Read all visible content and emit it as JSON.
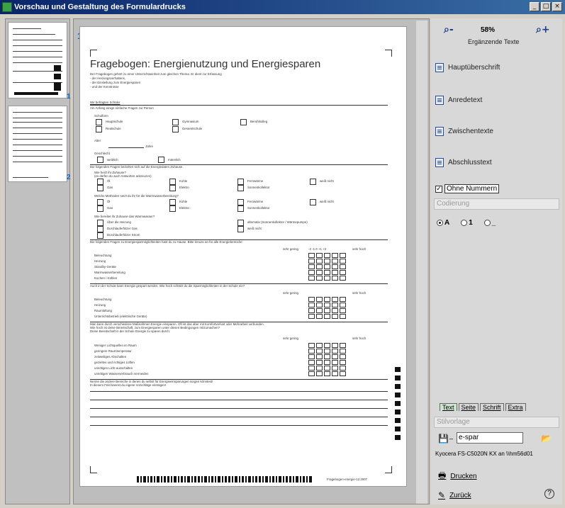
{
  "window": {
    "title": "Vorschau und Gestaltung des Formulardrucks",
    "controls": [
      "_",
      "□",
      "×"
    ]
  },
  "thumbnails": {
    "items": [
      {
        "num": "1"
      },
      {
        "num": "2"
      }
    ]
  },
  "preview": {
    "page_number": "1",
    "doc": {
      "title": "Fragebogen:   Energienutzung und Energiesparen",
      "intro": [
        "Der Fragebogen gehört zu einer Unterrichtseinheit zum gleichen Thema. Er dient zur Erfassung",
        "- der Heizungsverhaltens,",
        "- der Einstellung zum Energiesparen",
        "- und der Kenntnisse"
      ],
      "s1_title": "Wir befragten Schüler",
      "s1_sub": "Am Anfang einige einfache Fragen zur Person",
      "schulform": "Schulform",
      "schulform_opts": [
        "Hauptschule",
        "Realschule",
        "Gymnasium",
        "Gesamtschule",
        "Berufskolleg"
      ],
      "alter": "Alter",
      "jahre": "Jahre",
      "geschlecht": "Geschlecht",
      "geschlecht_opts": [
        "weiblich",
        "männlich"
      ],
      "q_energy": "Die folgenden Fragen beziehen sich auf die Energiedaten Zuhause.",
      "q_heat": "Wie heizt ihr Zuhause?",
      "q_heat_sub": "(es dürfen du auch Antworten ankreuzen)",
      "heat_opts": [
        "Öl",
        "Gas",
        "Kohle",
        "Elektro",
        "Fernwärme",
        "Sonnenkollektor",
        "weiß nicht"
      ],
      "q_warm": "Welche Methoden setzt du ihr für die Warmwasserbereitung?",
      "warm_opts": [
        "Öl",
        "Gas",
        "Kohle",
        "Elektro",
        "Fernwärme",
        "Sonnenkollektor",
        "weiß nicht"
      ],
      "q_water": "Wie bereitet ihr Zuhause das Warmwasser?",
      "water_opts": [
        "Über die Heizung",
        "Durchlauferhitzer Gas",
        "Durchlauferhitzer Strom",
        "alternativ (Sonnenkollektor / Wärmepumpe)",
        "weiß nicht"
      ],
      "q_rate": "Die folgenden Fragen zu Energiesparmöglichkeiten hast du zu Hause. Bitte kreuze an für alle Energiebereiche:",
      "scale_low": "sehr gering",
      "scale_nums": [
        "-2",
        "-1",
        "0",
        "+1",
        "+2"
      ],
      "scale_high": "sehr hoch",
      "rate1_items": [
        "Beleuchtung",
        "Heizung",
        "Standby-Geräte",
        "Warmwasserbereitung",
        "Kochen / Kühlen"
      ],
      "q_school": "Auch in der Schule kann Energie gespart werden. Wie hoch schätzt du die Sparmöglichkeiten in der Schule ein?",
      "rate2_items": [
        "Beleuchtung",
        "Heizung",
        "Raumlüftung",
        "Unterrichtsbetrieb (elektrische Geräte)"
      ],
      "q_measures": "Man kann durch verschiedene Maßnahmen Energie einsparen. Oft ist das aber mit Komfortverlust oder Mehrarbeit verbunden.",
      "q_measures2": "Wie hoch ist deine Bereitschaft, zum Energiesparen unter diesen Bedingungen mitzumachen?",
      "q_measures3": "Deine Bereitschaft in der Schule Energie zu sparen durch:",
      "rate3_items": [
        "Weniger Lichtquellen im Raum",
        "geringere Raumtemperatur",
        "zeitweiliges Abschalten",
        "gezieltes und richtiges Lüften",
        "unnötiges Licht ausschalten",
        "unnötigen Wasserverbrauch vermeiden"
      ],
      "q_free": "Nenne die andere Bereiche in denen du selbst für Energieeinsparungen sorgen könntest!",
      "q_free_sub": "In diesem Feld kannst du eigene Vorschläge eintragen!",
      "footer_code": "Fragebogen-energie-12.2007"
    }
  },
  "panel": {
    "zoom_out": "⌕-",
    "zoom_value": "58%",
    "zoom_in": "⌕+",
    "ergaenzende": "Ergänzende Texte",
    "text_buttons": [
      "Hauptüberschrift",
      "Anredetext",
      "Zwischentexte",
      "Abschlusstext"
    ],
    "ohne_nummern": "Ohne Nummern",
    "ohne_checked": "✓",
    "codierung": "Codierung",
    "codierung_opts": [
      "A",
      "1",
      "_"
    ],
    "tabs": [
      "Text",
      "Seite",
      "Schrift",
      "Extra"
    ],
    "stilvorlage": "Stilvorlage",
    "stil_value": "e-spar",
    "printer": "Kyocera FS-C5020N KX an \\\\hm56d01",
    "drucken": "Drucken",
    "zurueck": "Zurück",
    "help": "?"
  }
}
